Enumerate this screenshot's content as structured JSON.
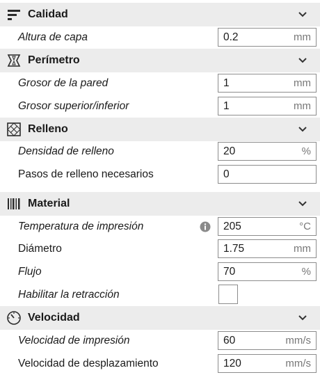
{
  "sections": {
    "calidad": {
      "title": "Calidad",
      "rows": [
        {
          "label": "Altura de capa",
          "value": "0.2",
          "unit": "mm"
        }
      ]
    },
    "perimetro": {
      "title": "Perímetro",
      "rows": [
        {
          "label": "Grosor de la pared",
          "value": "1",
          "unit": "mm"
        },
        {
          "label": "Grosor superior/inferior",
          "value": "1",
          "unit": "mm"
        }
      ]
    },
    "relleno": {
      "title": "Relleno",
      "rows": [
        {
          "label": "Densidad de relleno",
          "value": "20",
          "unit": "%"
        },
        {
          "label": "Pasos de relleno necesarios",
          "value": "0",
          "unit": ""
        }
      ]
    },
    "material": {
      "title": "Material",
      "rows": [
        {
          "label": "Temperatura de impresión",
          "value": "205",
          "unit": "°C"
        },
        {
          "label": "Diámetro",
          "value": "1.75",
          "unit": "mm"
        },
        {
          "label": "Flujo",
          "value": "70",
          "unit": "%"
        },
        {
          "label": "Habilitar la retracción",
          "checked": false
        }
      ]
    },
    "velocidad": {
      "title": "Velocidad",
      "rows": [
        {
          "label": "Velocidad de impresión",
          "value": "60",
          "unit": "mm/s"
        },
        {
          "label": "Velocidad de desplazamiento",
          "value": "120",
          "unit": "mm/s"
        }
      ]
    }
  },
  "icons": {
    "calidad": "quality-icon",
    "perimetro": "shell-icon",
    "relleno": "infill-icon",
    "material": "material-icon",
    "velocidad": "speed-icon",
    "collapse": "chevron-down-icon",
    "info": "info-icon"
  },
  "colors": {
    "header_bg": "#ececec",
    "field_border": "#8c8c8c",
    "unit_text": "#777777"
  }
}
